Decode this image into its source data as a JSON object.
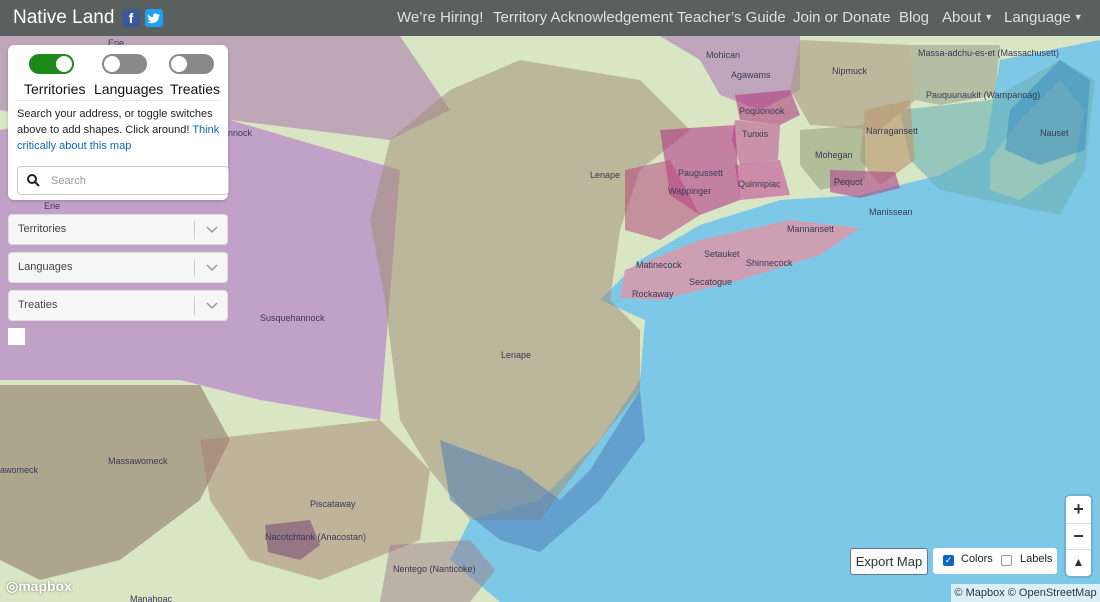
{
  "header": {
    "brand": "Native Land",
    "nav": [
      "We’re Hiring!",
      "Territory Acknowledgement",
      "Teacher’s Guide",
      "Join or Donate",
      "Blog",
      "About",
      "Language"
    ]
  },
  "panel": {
    "toggles": [
      {
        "label": "Territories",
        "on": true
      },
      {
        "label": "Languages",
        "on": false
      },
      {
        "label": "Treaties",
        "on": false
      }
    ],
    "info_text": "Search your address, or toggle switches above to add shapes. Click around! ",
    "info_link": "Think critically about this map",
    "search_placeholder": "Search"
  },
  "filters": [
    "Territories",
    "Languages",
    "Treaties"
  ],
  "map_labels": [
    "Erie",
    "Massa-adchu-es-et (Massachusett)",
    "Mohican",
    "Nipmuck",
    "Agawams",
    "Pauquunaukit (Wampanoag)",
    "Poquonook",
    "Narragansett",
    "Nauset",
    "Tunxis",
    "Mohegan",
    "Paugussett",
    "Lenape",
    "Wappinger",
    "Quinnipiac",
    "Pequot",
    "Manissean",
    "Mannansett",
    "Matinecock",
    "Setauket",
    "Shinnecock",
    "Secatogue",
    "Rockaway",
    "Susquehannock",
    "Lenape",
    "Massawomeck",
    "Piscataway",
    "Nacotchtank (Anacostan)",
    "Nentego (Nanticoke)",
    "Manahoac",
    "nnock",
    "Erie",
    "awomeck"
  ],
  "controls": {
    "export": "Export Map",
    "colors_label": "Colors",
    "labels_label": "Labels",
    "zoom_in": "+",
    "zoom_out": "−",
    "compass": "▲"
  },
  "attribution": "© Mapbox © OpenStreetMap",
  "logo": "mapbox",
  "colors": {
    "toggle_on": "#1a8a1a",
    "toggle_off": "#888888",
    "ocean": "#7dc8e6",
    "topbar": "#3a4047"
  }
}
